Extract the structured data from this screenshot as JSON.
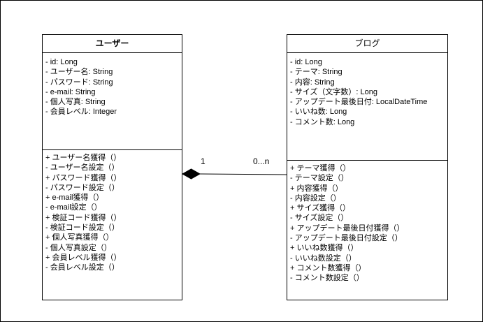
{
  "user_class": {
    "name": "ユーザー",
    "attributes": [
      "- id: Long",
      "- ユーザー名: String",
      "- パスワード: String",
      "- e-mail: String",
      "- 個人写真: String",
      "- 会員レベル: Integer"
    ],
    "operations": [
      "+ ユーザー名獲得（）",
      "- ユーザー名設定（）",
      "+ パスワード獲得（）",
      "- パスワード設定（）",
      "+ e-mail獲得（）",
      "- e-mail設定（）",
      "+ 検証コード獲得（）",
      "- 検証コード設定（）",
      "+ 個人写真獲得（）",
      "- 個人写真設定（）",
      "+ 会員レベル獲得（）",
      "- 会員レベル設定（）"
    ]
  },
  "blog_class": {
    "name": "ブログ",
    "attributes": [
      "- id: Long",
      "- テーマ: String",
      "- 内容: String",
      "- サイズ（文字数）: Long",
      "- アップデート最後日付: LocalDateTime",
      "- いいね数: Long",
      "- コメント数: Long"
    ],
    "operations": [
      "+ テーマ獲得（）",
      "- テーマ設定（）",
      "+ 内容獲得（）",
      "- 内容設定（）",
      "+ サイズ獲得（）",
      "- サイズ設定（）",
      "+ アップデート最後日付獲得（）",
      "- アップデート最後日付設定（）",
      "+ いいね数獲得（）",
      "- いいね数設定（）",
      "+ コメント数獲得（）",
      "- コメント数設定（）"
    ]
  },
  "association": {
    "type": "composition",
    "source_multiplicity": "1",
    "target_multiplicity": "0...n"
  }
}
